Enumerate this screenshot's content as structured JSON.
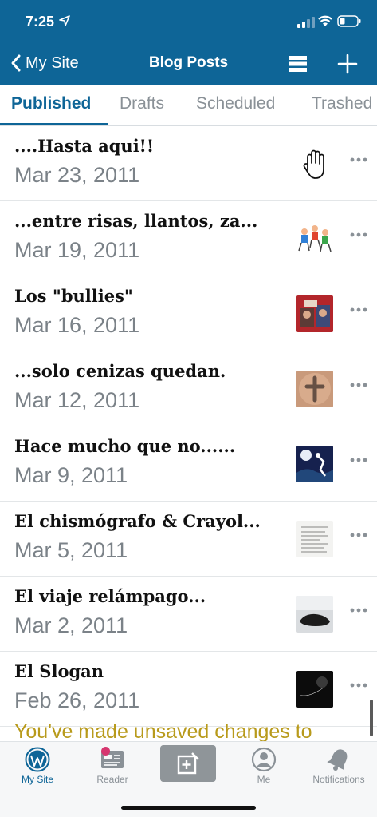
{
  "status_bar": {
    "time": "7:25"
  },
  "nav": {
    "back_label": "My Site",
    "title": "Blog Posts"
  },
  "tabs": [
    {
      "label": "Published",
      "active": true
    },
    {
      "label": "Drafts"
    },
    {
      "label": "Scheduled"
    },
    {
      "label": "Trashed"
    }
  ],
  "posts": [
    {
      "title": "....Hasta aqui!!",
      "date": "Mar 23, 2011",
      "thumb_icon": "hand-stop-icon"
    },
    {
      "title": "...entre risas, llantos, za...",
      "date": "Mar 19, 2011",
      "thumb_icon": "kids-illustration"
    },
    {
      "title": "Los \"bullies\"",
      "date": "Mar 16, 2011",
      "thumb_icon": "photo-red"
    },
    {
      "title": "...solo cenizas quedan.",
      "date": "Mar 12, 2011",
      "thumb_icon": "ash-cross-photo"
    },
    {
      "title": "Hace mucho que no......",
      "date": "Mar 9, 2011",
      "thumb_icon": "night-scene-photo"
    },
    {
      "title": "El chismógrafo & Crayol...",
      "date": "Mar 5, 2011",
      "thumb_icon": "document-scan"
    },
    {
      "title": "El viaje relámpago...",
      "date": "Mar 2, 2011",
      "thumb_icon": "car-photo"
    },
    {
      "title": "El Slogan",
      "date": "Feb 26, 2011",
      "thumb_icon": "black-logo-photo"
    }
  ],
  "notice": "You've made unsaved changes to",
  "tabbar": {
    "items": [
      {
        "label": "My Site",
        "icon": "wordpress-icon",
        "active": true
      },
      {
        "label": "Reader",
        "icon": "reader-icon"
      },
      {
        "label": "",
        "icon": "write-icon"
      },
      {
        "label": "Me",
        "icon": "user-icon"
      },
      {
        "label": "Notifications",
        "icon": "bell-icon"
      }
    ]
  },
  "colors": {
    "brand": "#0e6597",
    "notice": "#b89a1b",
    "inactive": "#8a9197"
  }
}
